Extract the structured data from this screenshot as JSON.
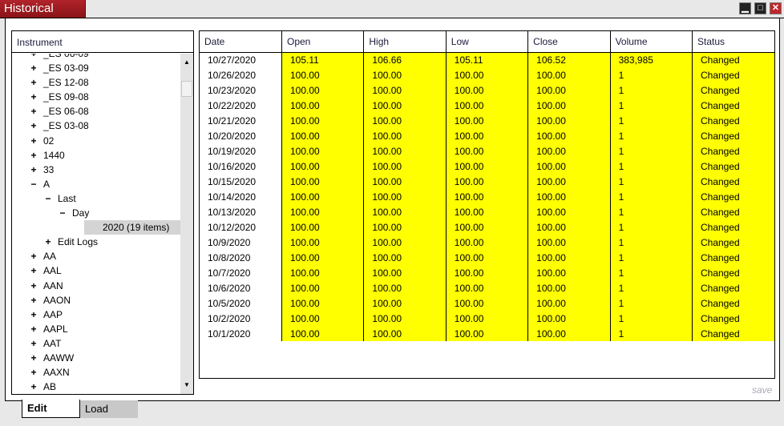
{
  "window": {
    "title": "Historical Data",
    "min": "▁",
    "max": "□",
    "close": "✕"
  },
  "tree": {
    "header": "Instrument",
    "items": [
      {
        "sym": "+",
        "label": "_ES 06-09",
        "indent": 0
      },
      {
        "sym": "+",
        "label": "_ES 03-09",
        "indent": 0
      },
      {
        "sym": "+",
        "label": "_ES 12-08",
        "indent": 0
      },
      {
        "sym": "+",
        "label": "_ES 09-08",
        "indent": 0
      },
      {
        "sym": "+",
        "label": "_ES 06-08",
        "indent": 0
      },
      {
        "sym": "+",
        "label": "_ES 03-08",
        "indent": 0
      },
      {
        "sym": "+",
        "label": "02",
        "indent": 0
      },
      {
        "sym": "+",
        "label": "1440",
        "indent": 0
      },
      {
        "sym": "+",
        "label": "33",
        "indent": 0
      },
      {
        "sym": "−",
        "label": "A",
        "indent": 0
      },
      {
        "sym": "−",
        "label": "Last",
        "indent": 1
      },
      {
        "sym": "−",
        "label": "Day",
        "indent": 2
      },
      {
        "sym": "",
        "label": "2020 (19 items)",
        "indent": 3,
        "selected": true
      },
      {
        "sym": "+",
        "label": "Edit Logs",
        "indent": 1
      },
      {
        "sym": "+",
        "label": "AA",
        "indent": 0
      },
      {
        "sym": "+",
        "label": "AAL",
        "indent": 0
      },
      {
        "sym": "+",
        "label": "AAN",
        "indent": 0
      },
      {
        "sym": "+",
        "label": "AAON",
        "indent": 0
      },
      {
        "sym": "+",
        "label": "AAP",
        "indent": 0
      },
      {
        "sym": "+",
        "label": "AAPL",
        "indent": 0
      },
      {
        "sym": "+",
        "label": "AAT",
        "indent": 0
      },
      {
        "sym": "+",
        "label": "AAWW",
        "indent": 0
      },
      {
        "sym": "+",
        "label": "AAXN",
        "indent": 0
      },
      {
        "sym": "+",
        "label": "AB",
        "indent": 0
      }
    ]
  },
  "grid": {
    "columns": [
      "Date",
      "Open",
      "High",
      "Low",
      "Close",
      "Volume",
      "Status"
    ],
    "rows": [
      [
        "10/27/2020",
        "105.11",
        "106.66",
        "105.11",
        "106.52",
        "383,985",
        "Changed"
      ],
      [
        "10/26/2020",
        "100.00",
        "100.00",
        "100.00",
        "100.00",
        "1",
        "Changed"
      ],
      [
        "10/23/2020",
        "100.00",
        "100.00",
        "100.00",
        "100.00",
        "1",
        "Changed"
      ],
      [
        "10/22/2020",
        "100.00",
        "100.00",
        "100.00",
        "100.00",
        "1",
        "Changed"
      ],
      [
        "10/21/2020",
        "100.00",
        "100.00",
        "100.00",
        "100.00",
        "1",
        "Changed"
      ],
      [
        "10/20/2020",
        "100.00",
        "100.00",
        "100.00",
        "100.00",
        "1",
        "Changed"
      ],
      [
        "10/19/2020",
        "100.00",
        "100.00",
        "100.00",
        "100.00",
        "1",
        "Changed"
      ],
      [
        "10/16/2020",
        "100.00",
        "100.00",
        "100.00",
        "100.00",
        "1",
        "Changed"
      ],
      [
        "10/15/2020",
        "100.00",
        "100.00",
        "100.00",
        "100.00",
        "1",
        "Changed"
      ],
      [
        "10/14/2020",
        "100.00",
        "100.00",
        "100.00",
        "100.00",
        "1",
        "Changed"
      ],
      [
        "10/13/2020",
        "100.00",
        "100.00",
        "100.00",
        "100.00",
        "1",
        "Changed"
      ],
      [
        "10/12/2020",
        "100.00",
        "100.00",
        "100.00",
        "100.00",
        "1",
        "Changed"
      ],
      [
        "10/9/2020",
        "100.00",
        "100.00",
        "100.00",
        "100.00",
        "1",
        "Changed"
      ],
      [
        "10/8/2020",
        "100.00",
        "100.00",
        "100.00",
        "100.00",
        "1",
        "Changed"
      ],
      [
        "10/7/2020",
        "100.00",
        "100.00",
        "100.00",
        "100.00",
        "1",
        "Changed"
      ],
      [
        "10/6/2020",
        "100.00",
        "100.00",
        "100.00",
        "100.00",
        "1",
        "Changed"
      ],
      [
        "10/5/2020",
        "100.00",
        "100.00",
        "100.00",
        "100.00",
        "1",
        "Changed"
      ],
      [
        "10/2/2020",
        "100.00",
        "100.00",
        "100.00",
        "100.00",
        "1",
        "Changed"
      ],
      [
        "10/1/2020",
        "100.00",
        "100.00",
        "100.00",
        "100.00",
        "1",
        "Changed"
      ]
    ]
  },
  "save_label": "save",
  "tabs": [
    "Edit",
    "Load"
  ]
}
